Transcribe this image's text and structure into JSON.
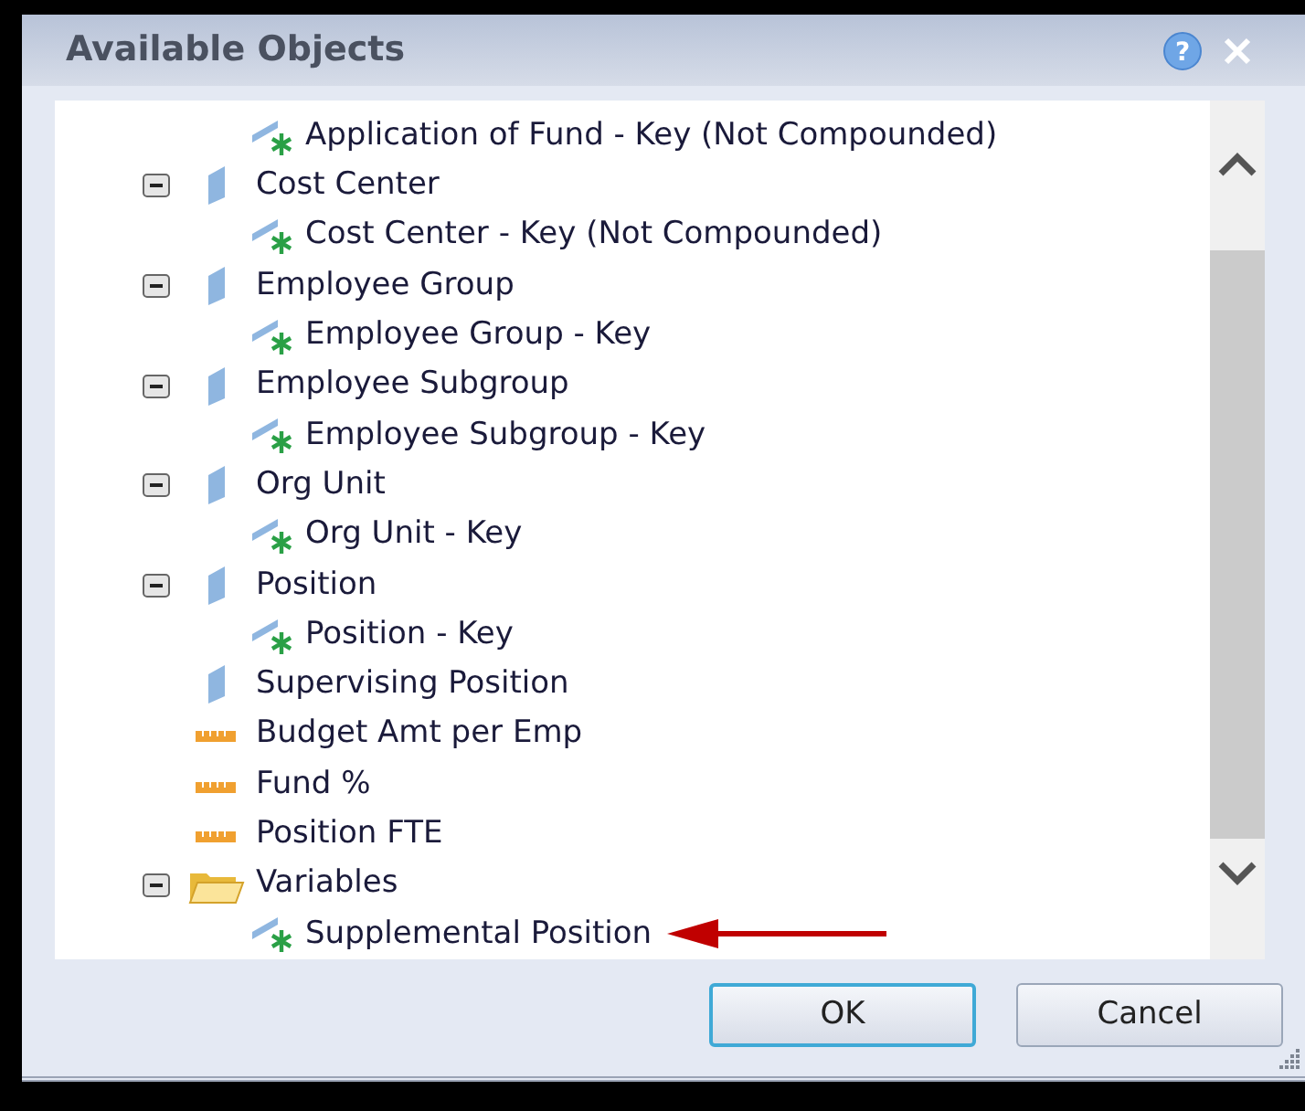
{
  "window": {
    "title": "Available Objects",
    "help_button": "?"
  },
  "tree": [
    {
      "kind": "key",
      "label": "Application of Fund - Key (Not Compounded)"
    },
    {
      "kind": "dimension",
      "label": "Cost Center",
      "expanded": true,
      "children": [
        {
          "kind": "key",
          "label": "Cost Center - Key (Not Compounded)"
        }
      ]
    },
    {
      "kind": "dimension",
      "label": "Employee Group",
      "expanded": true,
      "children": [
        {
          "kind": "key",
          "label": "Employee Group - Key"
        }
      ]
    },
    {
      "kind": "dimension",
      "label": "Employee Subgroup",
      "expanded": true,
      "children": [
        {
          "kind": "key",
          "label": "Employee Subgroup - Key"
        }
      ]
    },
    {
      "kind": "dimension",
      "label": "Org Unit",
      "expanded": true,
      "children": [
        {
          "kind": "key",
          "label": "Org Unit - Key"
        }
      ]
    },
    {
      "kind": "dimension",
      "label": "Position",
      "expanded": true,
      "children": [
        {
          "kind": "key",
          "label": "Position - Key"
        }
      ]
    },
    {
      "kind": "dimension",
      "label": "Supervising Position"
    },
    {
      "kind": "measure",
      "label": "Budget Amt per Emp"
    },
    {
      "kind": "measure",
      "label": "Fund %"
    },
    {
      "kind": "measure",
      "label": "Position FTE"
    },
    {
      "kind": "folder",
      "label": "Variables",
      "expanded": true,
      "children": [
        {
          "kind": "key",
          "label": "Supplemental Position"
        }
      ]
    }
  ],
  "buttons": [
    {
      "label": "OK",
      "default": true
    },
    {
      "label": "Cancel",
      "default": false
    }
  ]
}
